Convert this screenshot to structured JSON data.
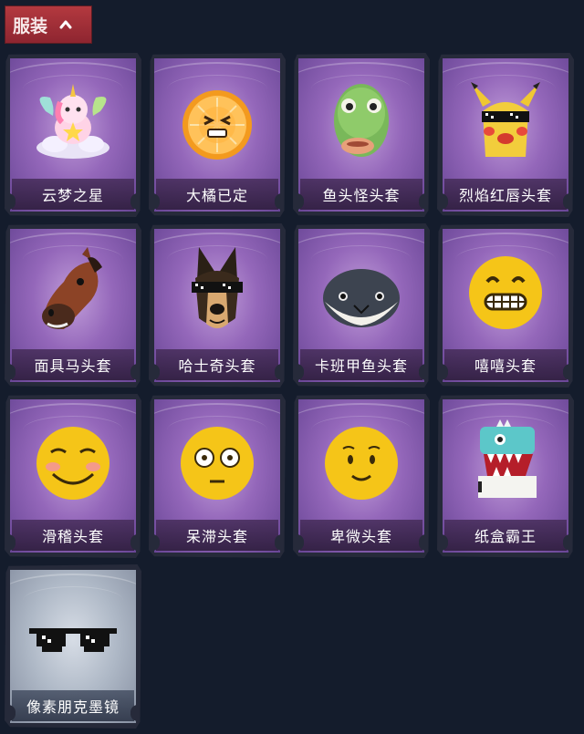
{
  "section": {
    "label": "服装",
    "icon": "chevron-up-icon",
    "accent": "#a52f36"
  },
  "items": [
    {
      "name": "云梦之星",
      "icon": "unicorn-star-icon",
      "tint": "purple"
    },
    {
      "name": "大橘已定",
      "icon": "orange-slice-icon",
      "tint": "purple"
    },
    {
      "name": "鱼头怪头套",
      "icon": "fish-head-mask-icon",
      "tint": "purple"
    },
    {
      "name": "烈焰红唇头套",
      "icon": "yellow-mouse-mask-icon",
      "tint": "purple"
    },
    {
      "name": "面具马头套",
      "icon": "horse-head-mask-icon",
      "tint": "purple"
    },
    {
      "name": "哈士奇头套",
      "icon": "husky-head-mask-icon",
      "tint": "purple"
    },
    {
      "name": "卡班甲鱼头套",
      "icon": "fish-ball-head-icon",
      "tint": "purple"
    },
    {
      "name": "嘻嘻头套",
      "icon": "grin-emoji-head-icon",
      "tint": "purple"
    },
    {
      "name": "滑稽头套",
      "icon": "smirk-emoji-head-icon",
      "tint": "purple"
    },
    {
      "name": "呆滞头套",
      "icon": "dazed-emoji-head-icon",
      "tint": "purple"
    },
    {
      "name": "卑微头套",
      "icon": "shy-emoji-head-icon",
      "tint": "purple"
    },
    {
      "name": "纸盒霸王",
      "icon": "cardboard-dino-icon",
      "tint": "purple"
    },
    {
      "name": "像素朋克墨镜",
      "icon": "pixel-sunglasses-icon",
      "tint": "blue"
    }
  ]
}
